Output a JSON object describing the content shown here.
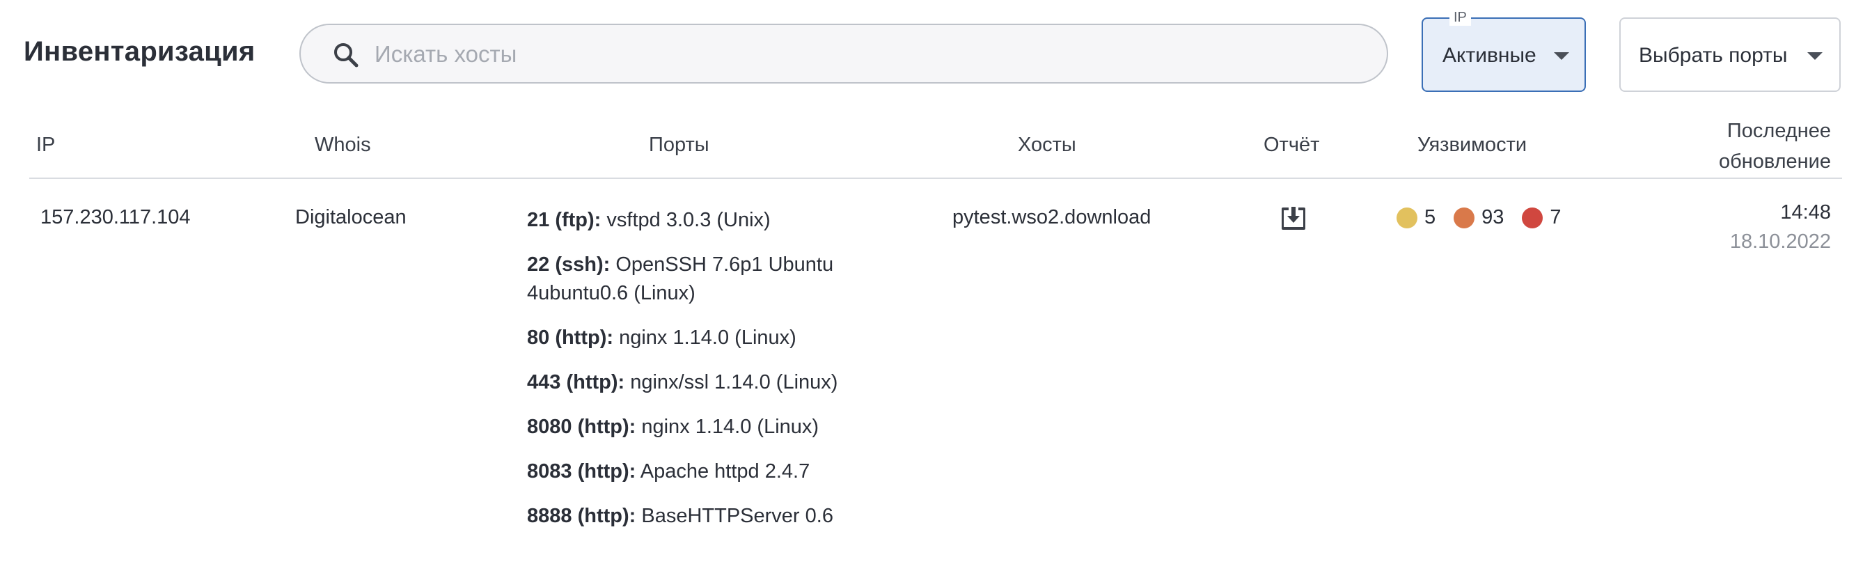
{
  "header": {
    "title": "Инвентаризация",
    "search_placeholder": "Искать хосты",
    "ip_filter": {
      "legend": "IP",
      "value": "Активные"
    },
    "ports_filter": {
      "value": "Выбрать порты"
    }
  },
  "table": {
    "columns": {
      "ip": "IP",
      "whois": "Whois",
      "ports": "Порты",
      "hosts": "Хосты",
      "report": "Отчёт",
      "vulns": "Уязвимости",
      "updated_line1": "Последнее",
      "updated_line2": "обновление"
    },
    "rows": [
      {
        "ip": "157.230.117.104",
        "whois": "Digitalocean",
        "ports": [
          {
            "label": "21 (ftp):",
            "service": "vsftpd 3.0.3 (Unix)"
          },
          {
            "label": "22 (ssh):",
            "service": "OpenSSH 7.6p1 Ubuntu 4ubuntu0.6 (Linux)"
          },
          {
            "label": "80 (http):",
            "service": "nginx 1.14.0 (Linux)"
          },
          {
            "label": "443 (http):",
            "service": "nginx/ssl 1.14.0 (Linux)"
          },
          {
            "label": "8080 (http):",
            "service": "nginx 1.14.0 (Linux)"
          },
          {
            "label": "8083 (http):",
            "service": "Apache httpd 2.4.7"
          },
          {
            "label": "8888 (http):",
            "service": "BaseHTTPServer 0.6"
          }
        ],
        "host": "pytest.wso2.download",
        "report_icon": "download-icon",
        "vulns": [
          {
            "count": "5",
            "color": "#e2c15e"
          },
          {
            "count": "93",
            "color": "#d9794a"
          },
          {
            "count": "7",
            "color": "#d0473f"
          }
        ],
        "updated_time": "14:48",
        "updated_date": "18.10.2022"
      }
    ]
  }
}
